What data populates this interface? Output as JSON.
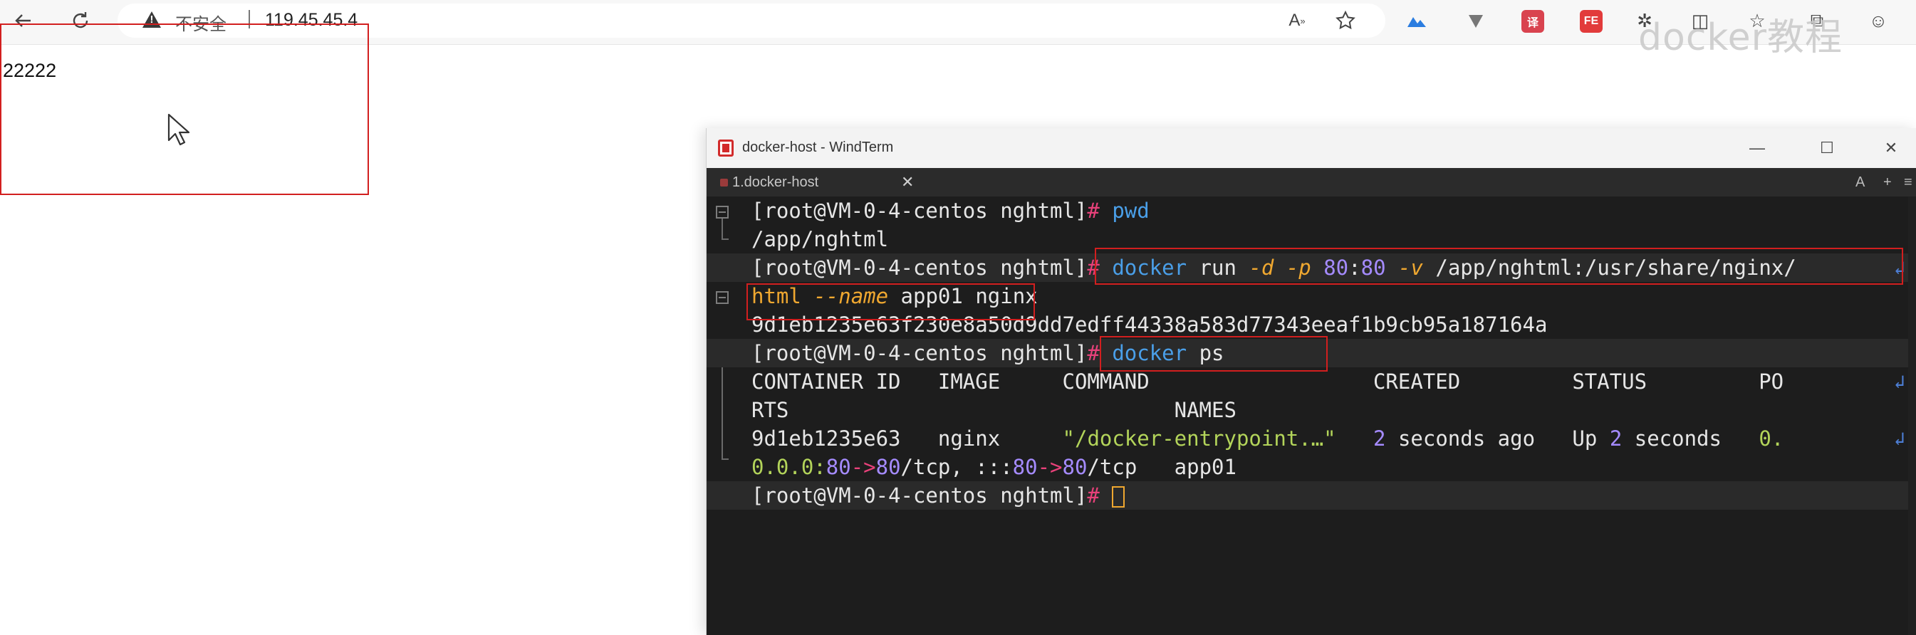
{
  "browser": {
    "security_label": "不安全",
    "url": "119.45.45.4",
    "watermark": "docker教程"
  },
  "page": {
    "body_text": "22222"
  },
  "window": {
    "title": "docker-host - WindTerm",
    "tab_label": "1.docker-host",
    "tab_right_a": "A",
    "tab_right_plus": "+"
  },
  "terminal": {
    "prompt": "[root@VM-0-4-centos nghtml]",
    "hash": "#",
    "cmd_pwd": "pwd",
    "pwd_output": "/app/nghtml",
    "run": {
      "docker": "docker",
      "run": "run",
      "flag_d": "-d",
      "flag_p": "-p",
      "port_host": "80",
      "port_colon": ":",
      "port_container": "80",
      "flag_v": "-v",
      "volume_a": "/app/nghtml:/usr/share/nginx/",
      "volume_b": "html",
      "flag_name": "--name",
      "name": "app01",
      "image": "nginx"
    },
    "container_hash": "9d1eb1235e63f230e8a50d9dd7edff44338a583d77343eeaf1b9cb95a187164a",
    "ps": {
      "docker": "docker",
      "ps": "ps"
    },
    "table_header_1": "CONTAINER ID   IMAGE     COMMAND                  CREATED         STATUS         PO",
    "table_header_2": "RTS                               NAMES",
    "row": {
      "id": "9d1eb1235e63",
      "image": "nginx",
      "command": "\"/docker-entrypoint.…\"",
      "created_num": "2",
      "created_text": "seconds ago",
      "status_text": "Up",
      "status_num": "2",
      "status_unit": "seconds",
      "ports_start": "0.",
      "ports_l2_a": "0.0.0:",
      "ports_l2_b": "80",
      "ports_l2_arrow": "->",
      "ports_l2_c": "80",
      "ports_l2_d": "/tcp, :::",
      "ports_l2_e": "80",
      "ports_l2_f": "->",
      "ports_l2_g": "80",
      "ports_l2_h": "/tcp",
      "names": "app01"
    }
  }
}
